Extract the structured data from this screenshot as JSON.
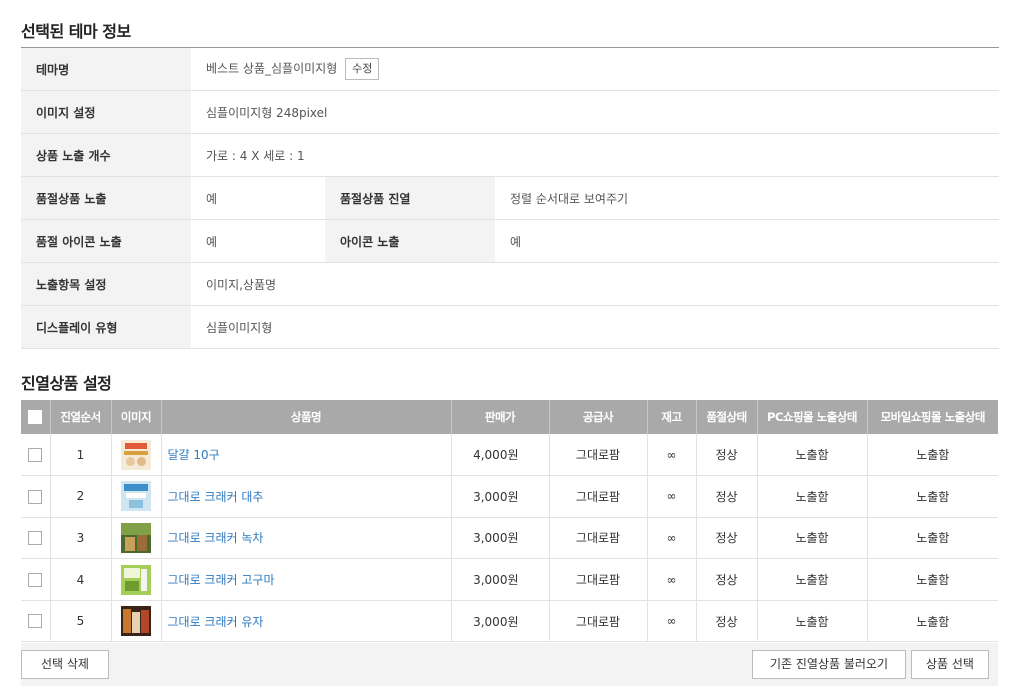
{
  "theme_info": {
    "title": "선택된 테마 정보",
    "rows": {
      "theme_name": {
        "label": "테마명",
        "value": "베스트 상품_심플이미지형",
        "edit_label": "수정"
      },
      "image_setting": {
        "label": "이미지 설정",
        "value": "심플이미지형 248pixel"
      },
      "display_count": {
        "label": "상품 노출 개수",
        "value": "가로 : 4 X 세로 : 1"
      },
      "soldout_display": {
        "label": "품절상품 노출",
        "value": "예"
      },
      "soldout_arrange": {
        "label": "품절상품 진열",
        "value": "정렬 순서대로 보여주기"
      },
      "soldout_icon": {
        "label": "품절 아이콘 노출",
        "value": "예"
      },
      "icon_display": {
        "label": "아이콘 노출",
        "value": "예"
      },
      "display_fields": {
        "label": "노출항목 설정",
        "value": "이미지,상품명"
      },
      "display_type": {
        "label": "디스플레이 유형",
        "value": "심플이미지형"
      }
    }
  },
  "display_products": {
    "title": "진열상품 설정",
    "columns": [
      "진열순서",
      "이미지",
      "상품명",
      "판매가",
      "공급사",
      "재고",
      "품절상태",
      "PC쇼핑몰 노출상태",
      "모바일쇼핑몰 노출상태"
    ],
    "rows": [
      {
        "order": "1",
        "thumb": "thumb-eggs",
        "name": "달걀 10구",
        "price": "4,000원",
        "supplier": "그대로팜",
        "stock": "∞",
        "soldout": "정상",
        "pc": "노출함",
        "mobile": "노출함"
      },
      {
        "order": "2",
        "thumb": "thumb-cracker-jujube",
        "name": "그대로 크래커 대추",
        "price": "3,000원",
        "supplier": "그대로팜",
        "stock": "∞",
        "soldout": "정상",
        "pc": "노출함",
        "mobile": "노출함"
      },
      {
        "order": "3",
        "thumb": "thumb-cracker-greentea",
        "name": "그대로 크래커 녹차",
        "price": "3,000원",
        "supplier": "그대로팜",
        "stock": "∞",
        "soldout": "정상",
        "pc": "노출함",
        "mobile": "노출함"
      },
      {
        "order": "4",
        "thumb": "thumb-cracker-sweetpotato",
        "name": "그대로 크래커 고구마",
        "price": "3,000원",
        "supplier": "그대로팜",
        "stock": "∞",
        "soldout": "정상",
        "pc": "노출함",
        "mobile": "노출함"
      },
      {
        "order": "5",
        "thumb": "thumb-cracker-yuja",
        "name": "그대로 크래커 유자",
        "price": "3,000원",
        "supplier": "그대로팜",
        "stock": "∞",
        "soldout": "정상",
        "pc": "노출함",
        "mobile": "노출함"
      }
    ]
  },
  "actions": {
    "delete_label": "선택 삭제",
    "load_label": "기존 진열상품 불러오기",
    "select_label": "상품 선택"
  },
  "colors": {
    "header_bg": "#a9a9a9",
    "label_bg": "#f3f3f3",
    "link": "#2f7abf"
  }
}
